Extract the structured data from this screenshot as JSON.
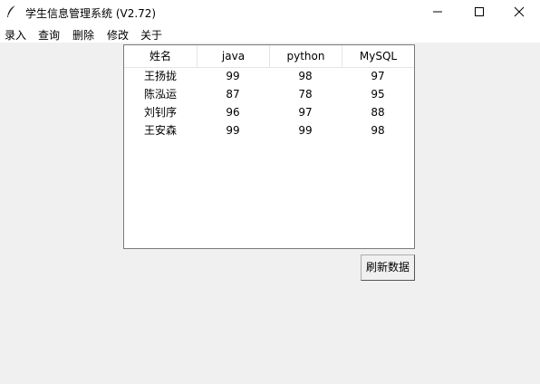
{
  "window": {
    "title": "学生信息管理系统 (V2.72)",
    "icon": "feather-icon"
  },
  "menu": {
    "items": [
      {
        "label": "录入"
      },
      {
        "label": "查询"
      },
      {
        "label": "删除"
      },
      {
        "label": "修改"
      },
      {
        "label": "关于"
      }
    ]
  },
  "table": {
    "columns": [
      "姓名",
      "java",
      "python",
      "MySQL"
    ],
    "rows": [
      [
        "王扬拢",
        "99",
        "98",
        "97"
      ],
      [
        "陈泓运",
        "87",
        "78",
        "95"
      ],
      [
        "刘钊序",
        "96",
        "97",
        "88"
      ],
      [
        "王安森",
        "99",
        "99",
        "98"
      ]
    ]
  },
  "actions": {
    "refresh_label": "刷新数据"
  }
}
